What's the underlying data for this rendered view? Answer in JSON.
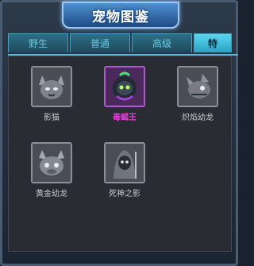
{
  "window": {
    "title": "宠物图鉴"
  },
  "tabs": [
    {
      "label": "野生"
    },
    {
      "label": "普通"
    },
    {
      "label": "高级"
    },
    {
      "label": "特"
    }
  ],
  "pets": [
    {
      "name": "影猫",
      "icon": "shadow-cat-icon"
    },
    {
      "name": "毒蝎王",
      "icon": "poison-scorpion-king-icon",
      "selected": true
    },
    {
      "name": "炽焰幼龙",
      "icon": "flame-dragon-icon"
    },
    {
      "name": "黄金幼龙",
      "icon": "golden-dragon-icon"
    },
    {
      "name": "死神之影",
      "icon": "death-shadow-icon"
    }
  ],
  "colors": {
    "selected_label": "#e03fd8",
    "tab_accent": "#5ab4d8"
  }
}
